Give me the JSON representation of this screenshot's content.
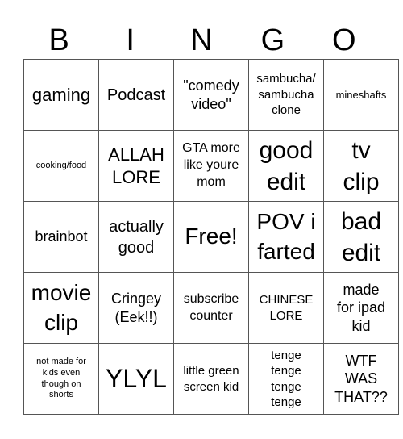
{
  "header": {
    "letters": [
      "B",
      "I",
      "N",
      "G",
      "O"
    ]
  },
  "grid": {
    "rows": [
      [
        "gaming",
        "Podcast",
        "\"comedy\nvideo\"",
        "sambucha/\nsambucha\nclone",
        "mineshafts"
      ],
      [
        "cooking/food",
        "ALLAH\nLORE",
        "GTA more\nlike youre\nmom",
        "good\nedit",
        "tv\nclip"
      ],
      [
        "brainbot",
        "actually\ngood",
        "Free!",
        "POV i\nfarted",
        "bad\nedit"
      ],
      [
        "movie\nclip",
        "Cringey\n(Eek!!)",
        "subscribe\ncounter",
        "CHINESE\nLORE",
        "made\nfor ipad\nkid"
      ],
      [
        "not made for\nkids even\nthough on\nshorts",
        "YLYL",
        "little green\nscreen kid",
        "tenge\ntenge\ntenge\ntenge",
        "WTF\nWAS\nTHAT??"
      ]
    ]
  }
}
